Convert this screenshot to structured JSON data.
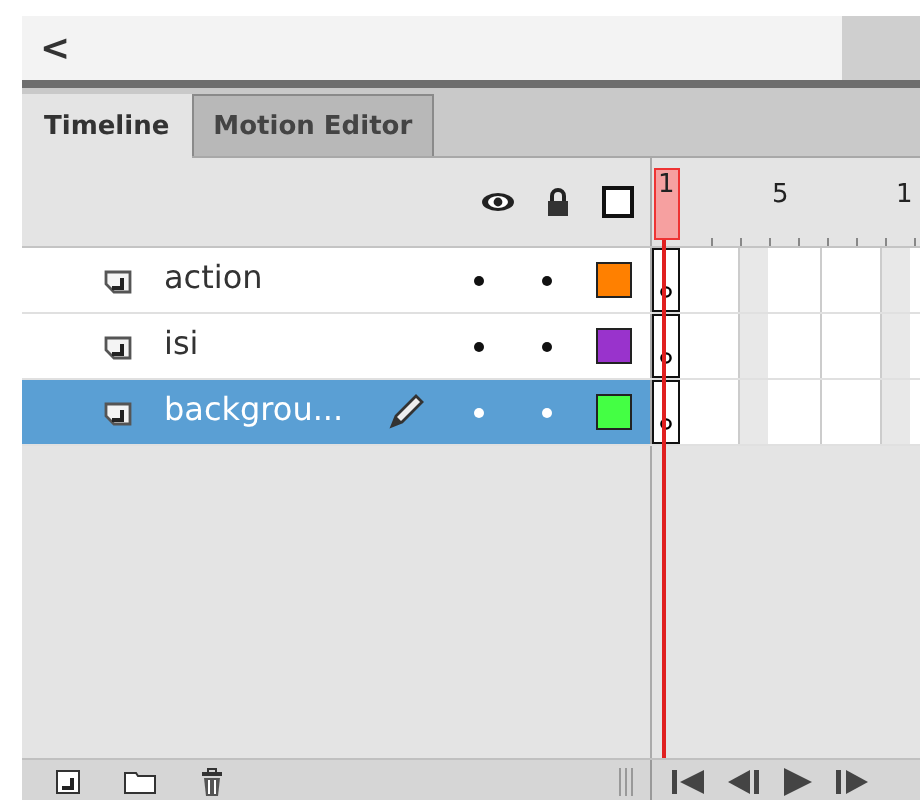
{
  "toolbar": {
    "back": "<"
  },
  "tabs": [
    {
      "label": "Timeline",
      "selected": true
    },
    {
      "label": "Motion Editor",
      "selected": false
    }
  ],
  "ruler": {
    "current": "1",
    "labels": [
      "5",
      "1"
    ]
  },
  "layers": [
    {
      "name": "action",
      "selected": false,
      "editing": false,
      "color": "#ff8000"
    },
    {
      "name": "isi",
      "selected": false,
      "editing": false,
      "color": "#9933cc"
    },
    {
      "name": "backgrou...",
      "selected": true,
      "editing": true,
      "color": "#44ff44"
    }
  ]
}
